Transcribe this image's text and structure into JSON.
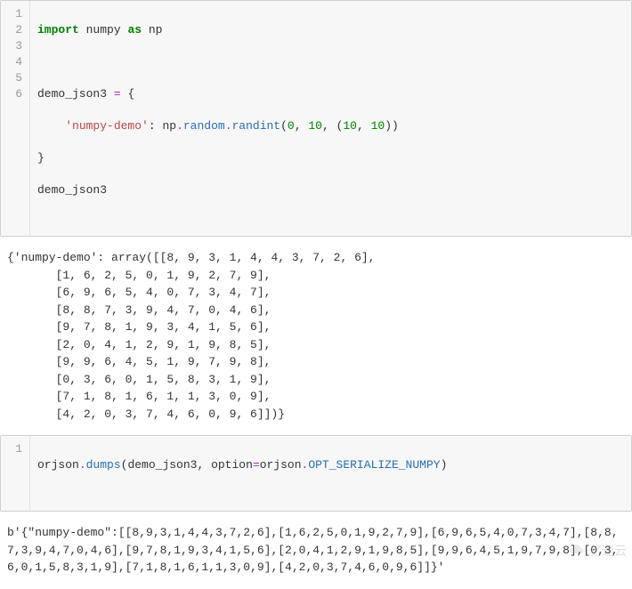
{
  "cell1": {
    "line_numbers": [
      "1",
      "2",
      "3",
      "4",
      "5",
      "6"
    ],
    "lines": {
      "l1": {
        "import": "import",
        "mod": "numpy",
        "as": "as",
        "alias": "np"
      },
      "l2": "",
      "l3": {
        "var": "demo_json3",
        "eq": "=",
        "brace_open": "{"
      },
      "l4": {
        "indent": "    ",
        "key": "'numpy-demo'",
        "colon": ": ",
        "ns": "np",
        "dot1": ".",
        "sub": "random",
        "dot2": ".",
        "fn": "randint",
        "paren_open": "(",
        "a0": "0",
        "c1": ", ",
        "a1": "10",
        "c2": ", ",
        "po2": "(",
        "a2": "10",
        "c3": ", ",
        "a3": "10",
        "pc2": ")",
        "paren_close": ")"
      },
      "l5": {
        "brace_close": "}"
      },
      "l6": {
        "stmt": "demo_json3"
      }
    }
  },
  "output1": "{'numpy-demo': array([[8, 9, 3, 1, 4, 4, 3, 7, 2, 6],\n       [1, 6, 2, 5, 0, 1, 9, 2, 7, 9],\n       [6, 9, 6, 5, 4, 0, 7, 3, 4, 7],\n       [8, 8, 7, 3, 9, 4, 7, 0, 4, 6],\n       [9, 7, 8, 1, 9, 3, 4, 1, 5, 6],\n       [2, 0, 4, 1, 2, 9, 1, 9, 8, 5],\n       [9, 9, 6, 4, 5, 1, 9, 7, 9, 8],\n       [0, 3, 6, 0, 1, 5, 8, 3, 1, 9],\n       [7, 1, 8, 1, 6, 1, 1, 3, 0, 9],\n       [4, 2, 0, 3, 7, 4, 6, 0, 9, 6]])}",
  "cell2": {
    "line_numbers": [
      "1"
    ],
    "lines": {
      "l1": {
        "ns": "orjson",
        "dot1": ".",
        "fn": "dumps",
        "po": "(",
        "arg0": "demo_json3",
        "c": ", ",
        "kwarg": "option",
        "eq": "=",
        "ns2": "orjson",
        "dot2": ".",
        "const": "OPT_SERIALIZE_NUMPY",
        "pc": ")"
      }
    }
  },
  "output2": "b'{\"numpy-demo\":[[8,9,3,1,4,4,3,7,2,6],[1,6,2,5,0,1,9,2,7,9],[6,9,6,5,4,0,7,3,4,7],[8,8,7,3,9,4,7,0,4,6],[9,7,8,1,9,3,4,1,5,6],[2,0,4,1,2,9,1,9,8,5],[9,9,6,4,5,1,9,7,9,8],[0,3,6,0,1,5,8,3,1,9],[7,1,8,1,6,1,1,3,0,9],[4,2,0,3,7,4,6,0,9,6]]}'",
  "watermark": "亿速云"
}
